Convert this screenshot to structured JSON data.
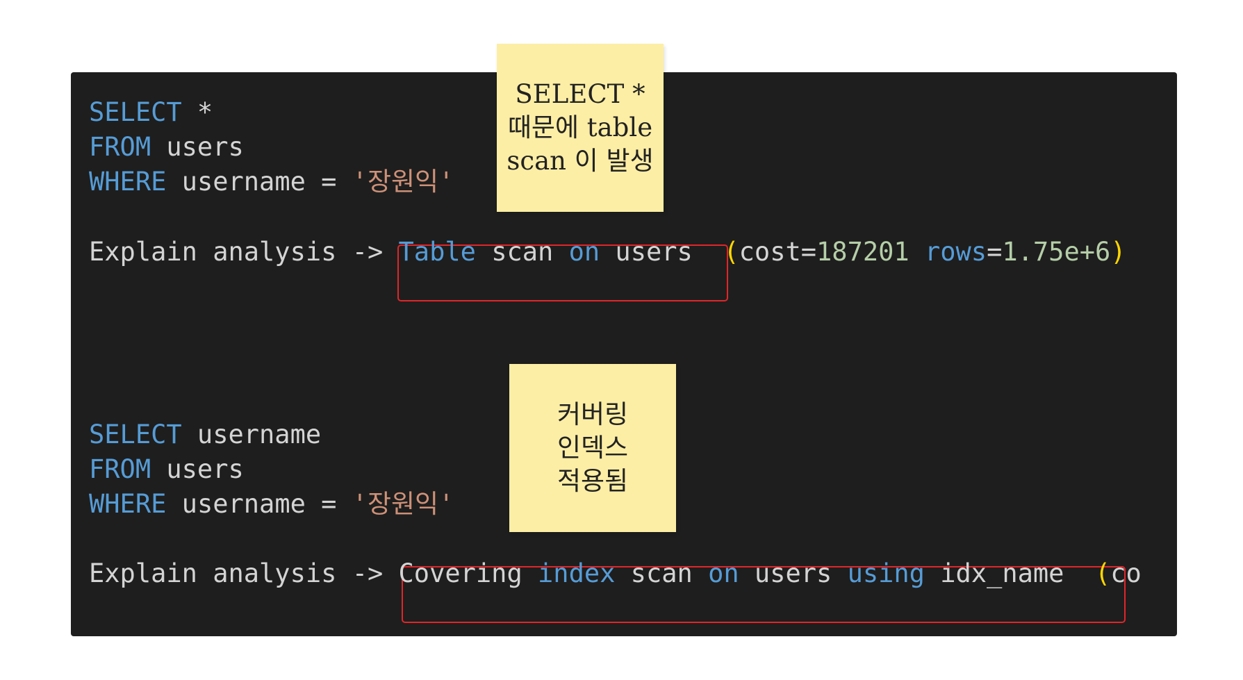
{
  "block1": {
    "line1": {
      "kw": "SELECT",
      "rest": " *"
    },
    "line2": {
      "kw": "FROM",
      "rest": " users"
    },
    "line3": {
      "kw": "WHERE",
      "rest": " username = ",
      "str": "'장원익'"
    },
    "explain": {
      "prefix": "Explain analysis -> ",
      "t1": "Table",
      "t2": " scan ",
      "t3": "on",
      "t4": " users",
      "open_paren": "(",
      "cost_key": "cost=",
      "cost_val": "187201",
      "rows_key": "rows",
      "rows_eq": "=",
      "rows_val": "1.75e+6",
      "close_paren": ")"
    }
  },
  "block2": {
    "line1": {
      "kw": "SELECT",
      "rest": " username"
    },
    "line2": {
      "kw": "FROM",
      "rest": " users"
    },
    "line3": {
      "kw": "WHERE",
      "rest": " username = ",
      "str": "'장원익'"
    },
    "explain": {
      "prefix": "Explain analysis -> ",
      "t1": "Covering ",
      "t2": "index",
      "t3": " scan ",
      "t4": "on",
      "t5": " users ",
      "t6": "using",
      "t7": " idx_name",
      "open_paren": "(",
      "tail": "co"
    }
  },
  "notes": {
    "note1": "SELECT *\n때문에 table\nscan 이 발생",
    "note2": "커버링\n인덱스\n적용됨"
  },
  "colors": {
    "background": "#1e1e1e",
    "keyword": "#569cd6",
    "string": "#ce9178",
    "number": "#b5cea8",
    "paren": "#ffd700",
    "highlight_border": "#e0262a",
    "sticky_note": "#fdeea5"
  }
}
